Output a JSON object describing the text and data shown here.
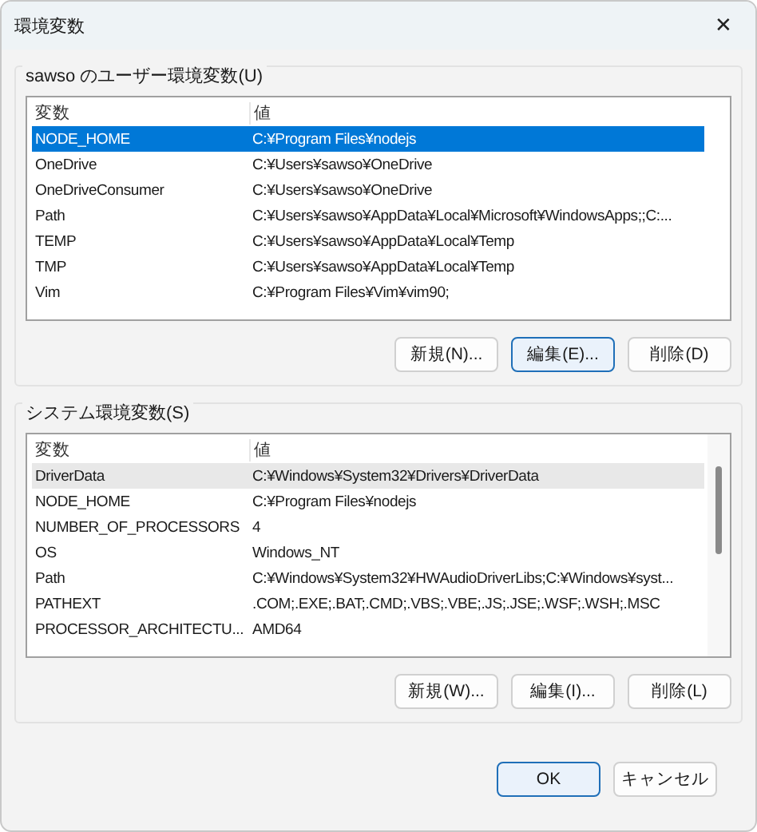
{
  "window": {
    "title": "環境変数",
    "close": "✕"
  },
  "groups": [
    {
      "label": "sawso のユーザー環境変数(U)",
      "columns": [
        "変数",
        "値"
      ],
      "scrollbar": false,
      "rows": [
        {
          "name": "NODE_HOME",
          "value": "C:¥Program Files¥nodejs",
          "selected": true,
          "hover": false
        },
        {
          "name": "OneDrive",
          "value": "C:¥Users¥sawso¥OneDrive",
          "selected": false,
          "hover": false
        },
        {
          "name": "OneDriveConsumer",
          "value": "C:¥Users¥sawso¥OneDrive",
          "selected": false,
          "hover": false
        },
        {
          "name": "Path",
          "value": "C:¥Users¥sawso¥AppData¥Local¥Microsoft¥WindowsApps;;C:...",
          "selected": false,
          "hover": false
        },
        {
          "name": "TEMP",
          "value": "C:¥Users¥sawso¥AppData¥Local¥Temp",
          "selected": false,
          "hover": false
        },
        {
          "name": "TMP",
          "value": "C:¥Users¥sawso¥AppData¥Local¥Temp",
          "selected": false,
          "hover": false
        },
        {
          "name": "Vim",
          "value": "C:¥Program Files¥Vim¥vim90;",
          "selected": false,
          "hover": false
        }
      ],
      "buttons": [
        {
          "label": "新規(N)...",
          "default": false
        },
        {
          "label": "編集(E)...",
          "default": true
        },
        {
          "label": "削除(D)",
          "default": false
        }
      ]
    },
    {
      "label": "システム環境変数(S)",
      "columns": [
        "変数",
        "値"
      ],
      "scrollbar": true,
      "rows": [
        {
          "name": "DriverData",
          "value": "C:¥Windows¥System32¥Drivers¥DriverData",
          "selected": false,
          "hover": true
        },
        {
          "name": "NODE_HOME",
          "value": "C:¥Program Files¥nodejs",
          "selected": false,
          "hover": false
        },
        {
          "name": "NUMBER_OF_PROCESSORS",
          "value": "4",
          "selected": false,
          "hover": false
        },
        {
          "name": "OS",
          "value": "Windows_NT",
          "selected": false,
          "hover": false
        },
        {
          "name": "Path",
          "value": "C:¥Windows¥System32¥HWAudioDriverLibs;C:¥Windows¥syst...",
          "selected": false,
          "hover": false
        },
        {
          "name": "PATHEXT",
          "value": ".COM;.EXE;.BAT;.CMD;.VBS;.VBE;.JS;.JSE;.WSF;.WSH;.MSC",
          "selected": false,
          "hover": false
        },
        {
          "name": "PROCESSOR_ARCHITECTU...",
          "value": "AMD64",
          "selected": false,
          "hover": false
        }
      ],
      "buttons": [
        {
          "label": "新規(W)...",
          "default": false
        },
        {
          "label": "編集(I)...",
          "default": false
        },
        {
          "label": "削除(L)",
          "default": false
        }
      ]
    }
  ],
  "footer_buttons": [
    {
      "label": "OK",
      "default": true
    },
    {
      "label": "キャンセル",
      "default": false
    }
  ]
}
